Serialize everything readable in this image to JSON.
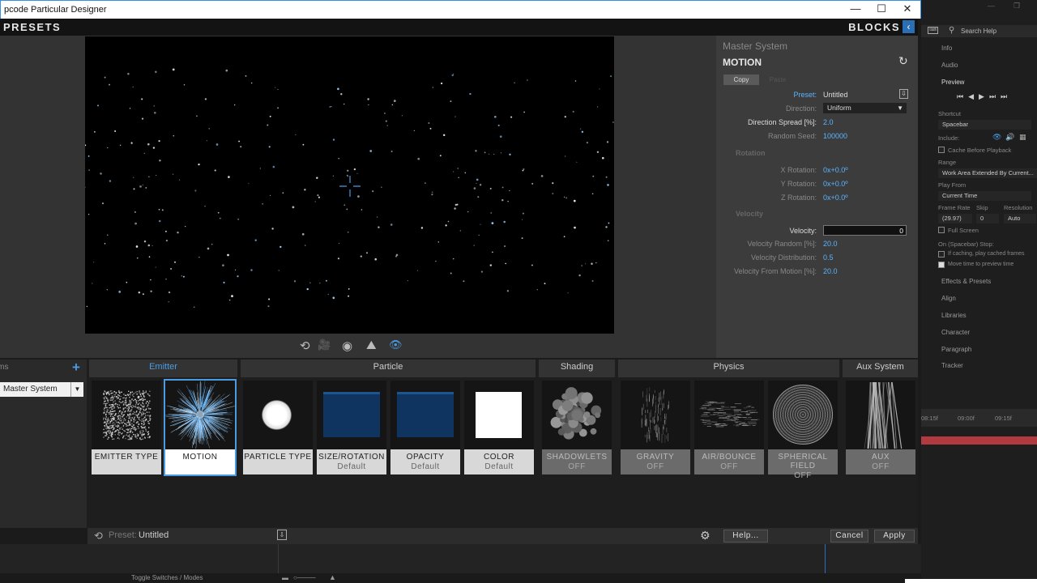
{
  "window": {
    "title": "pcode Particular Designer",
    "minimize": "—",
    "maximize": "☐",
    "close": "✕"
  },
  "header": {
    "presets_label": "PRESETS",
    "blocks_label": "BLOCKS",
    "collapse_icon": "‹"
  },
  "view_controls": [
    "⟲",
    "🎥",
    "◉",
    "⛰",
    "👁"
  ],
  "panel": {
    "group": "Master System",
    "title": "MOTION",
    "reset_icon": "↻",
    "copy_label": "Copy",
    "paste_label": "Paste",
    "preset_label": "Preset:",
    "preset_value": "Untitled",
    "direction_label": "Direction:",
    "direction_value": "Uniform",
    "direction_spread_label": "Direction Spread [%]:",
    "direction_spread_value": "2.0",
    "random_seed_label": "Random Seed:",
    "random_seed_value": "100000",
    "rotation_section": "Rotation",
    "x_rotation_label": "X Rotation:",
    "x_rotation_value": "0x+0.0º",
    "y_rotation_label": "Y Rotation:",
    "y_rotation_value": "0x+0.0º",
    "z_rotation_label": "Z Rotation:",
    "z_rotation_value": "0x+0.0º",
    "velocity_section": "Velocity",
    "velocity_label": "Velocity:",
    "velocity_value": "0",
    "velocity_random_label": "Velocity Random [%]:",
    "velocity_random_value": "20.0",
    "velocity_distribution_label": "Velocity Distribution:",
    "velocity_distribution_value": "0.5",
    "velocity_from_motion_label": "Velocity From Motion [%]:",
    "velocity_from_motion_value": "20.0"
  },
  "systems": {
    "header": "Items",
    "add_icon": "+",
    "selected": "Master System"
  },
  "categories": [
    "Emitter",
    "Particle",
    "Shading",
    "Physics",
    "Aux System"
  ],
  "tiles": [
    {
      "label": "EMITTER TYPE",
      "sub": ""
    },
    {
      "label": "MOTION",
      "sub": ""
    },
    {
      "label": "PARTICLE TYPE",
      "sub": ""
    },
    {
      "label": "SIZE/ROTATION",
      "sub": "Default"
    },
    {
      "label": "OPACITY",
      "sub": "Default"
    },
    {
      "label": "COLOR",
      "sub": "Default"
    },
    {
      "label": "SHADOWLETS",
      "sub": "OFF"
    },
    {
      "label": "GRAVITY",
      "sub": "OFF"
    },
    {
      "label": "AIR/BOUNCE",
      "sub": "OFF"
    },
    {
      "label": "SPHERICAL FIELD",
      "sub": "OFF"
    },
    {
      "label": "AUX",
      "sub": "OFF"
    }
  ],
  "footer": {
    "preset_label": "Preset:",
    "preset_value": "Untitled",
    "help_label": "Help...",
    "cancel_label": "Cancel",
    "apply_label": "Apply"
  },
  "ae": {
    "search_placeholder": "Search Help",
    "info": "Info",
    "audio": "Audio",
    "preview": "Preview",
    "shortcut_label": "Shortcut",
    "shortcut_value": "Spacebar",
    "include_label": "Include:",
    "cache_before": "Cache Before Playback",
    "range_label": "Range",
    "range_value": "Work Area Extended By Current...",
    "play_from_label": "Play From",
    "play_from_value": "Current Time",
    "frame_rate_label": "Frame Rate",
    "skip_label": "Skip",
    "resolution_label": "Resolution",
    "frame_rate_value": "(29.97)",
    "skip_value": "0",
    "resolution_value": "Auto",
    "full_screen": "Full Screen",
    "stop_label": "On (Spacebar) Stop:",
    "if_caching": "If caching, play cached frames",
    "move_time": "Move time to preview time",
    "effects_presets": "Effects & Presets",
    "align": "Align",
    "libraries": "Libraries",
    "character": "Character",
    "paragraph": "Paragraph",
    "tracker": "Tracker",
    "t1": "08:15f",
    "t2": "09:00f",
    "t3": "09:15f"
  },
  "bottom": {
    "toggle_switches": "Toggle Switches / Modes"
  },
  "colors": {
    "accent": "#4b9be0",
    "value_blue": "#5ab4ff",
    "panel_bg": "#3c3c3c",
    "timeline_bar": "#b03a40"
  }
}
